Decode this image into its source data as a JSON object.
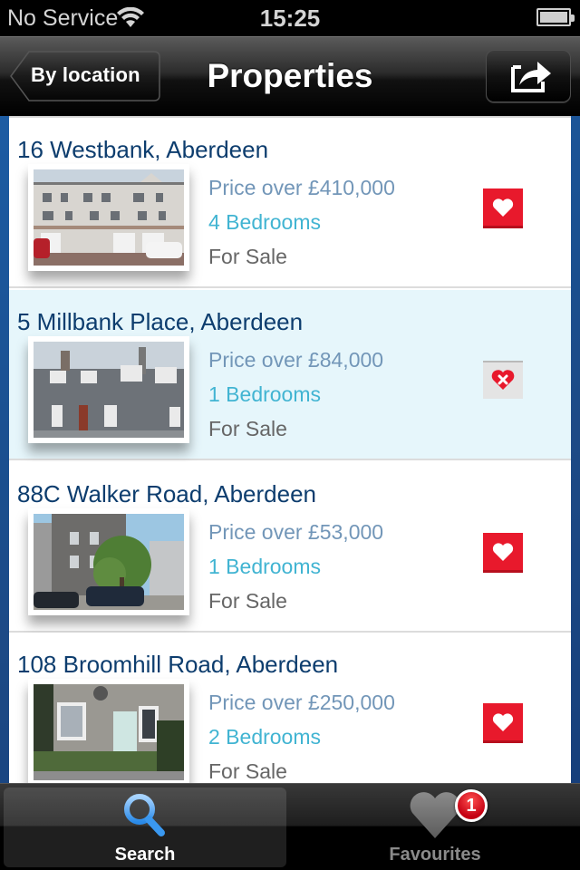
{
  "status_bar": {
    "carrier": "No Service",
    "time": "15:25",
    "wifi_icon": "wifi-icon",
    "battery_icon": "battery-full-icon"
  },
  "nav_bar": {
    "back_label": "By location",
    "title": "Properties",
    "share_icon": "share-icon"
  },
  "listings": [
    {
      "address": "16 Westbank, Aberdeen",
      "price": "Price over £410,000",
      "bedrooms": "4 Bedrooms",
      "status": "For Sale",
      "favourite_icon": "heart-add-icon",
      "is_favourite": false,
      "selected": false
    },
    {
      "address": "5 Millbank Place, Aberdeen",
      "price": "Price over £84,000",
      "bedrooms": "1 Bedrooms",
      "status": "For Sale",
      "favourite_icon": "heart-remove-icon",
      "is_favourite": true,
      "selected": true
    },
    {
      "address": "88C  Walker Road, Aberdeen",
      "price": "Price over £53,000",
      "bedrooms": "1 Bedrooms",
      "status": "For Sale",
      "favourite_icon": "heart-add-icon",
      "is_favourite": false,
      "selected": false
    },
    {
      "address": "108 Broomhill Road, Aberdeen",
      "price": "Price over £250,000",
      "bedrooms": "2 Bedrooms",
      "status": "For Sale",
      "favourite_icon": "heart-add-icon",
      "is_favourite": false,
      "selected": false
    }
  ],
  "tab_bar": {
    "tabs": [
      {
        "label": "Search",
        "icon": "search-icon",
        "active": true
      },
      {
        "label": "Favourites",
        "icon": "heart-icon",
        "active": false,
        "badge": "1"
      }
    ]
  },
  "colors": {
    "address": "#0d3d6e",
    "price": "#7296b8",
    "bedrooms": "#41b4d2",
    "status": "#666666",
    "favourite_red": "#e8192c",
    "selected_row": "#e6f6fb",
    "background_blue": "#1a4f8f"
  }
}
